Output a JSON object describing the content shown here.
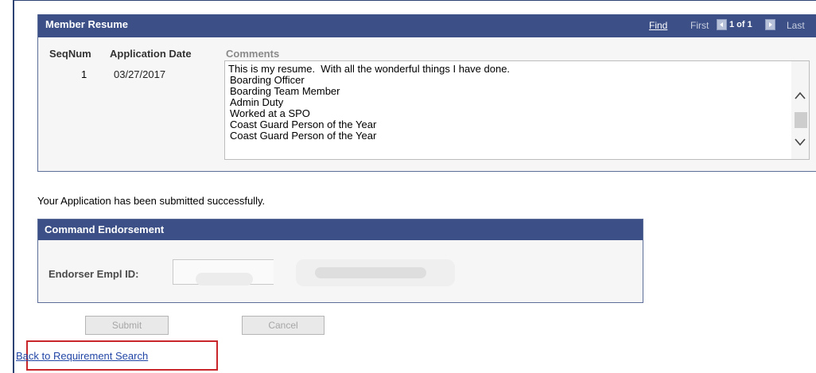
{
  "member_resume": {
    "title": "Member Resume",
    "find_label": "Find",
    "nav_first": "First",
    "nav_count": "1 of 1",
    "nav_last": "Last",
    "columns": {
      "seqnum": "SeqNum",
      "application_date": "Application Date",
      "comments": "Comments"
    },
    "row": {
      "seqnum": "1",
      "application_date": "03/27/2017",
      "comment_lines": [
        "This is my resume.  With all the wonderful things I have done.",
        "Boarding Officer",
        "Boarding Team Member",
        "Admin Duty",
        "Worked at a SPO",
        "Coast Guard Person of the Year",
        "Coast Guard Person of the Year"
      ]
    }
  },
  "success_message": "Your Application has been submitted successfully.",
  "command_endorsement": {
    "title": "Command Endorsement",
    "endorser_label": "Endorser Empl ID:"
  },
  "buttons": {
    "submit": "Submit",
    "cancel": "Cancel"
  },
  "back_link": "Back to Requirement Search",
  "colors": {
    "header_bg": "#3c5087",
    "link": "#2347a6",
    "highlight_border": "#c9262b"
  }
}
